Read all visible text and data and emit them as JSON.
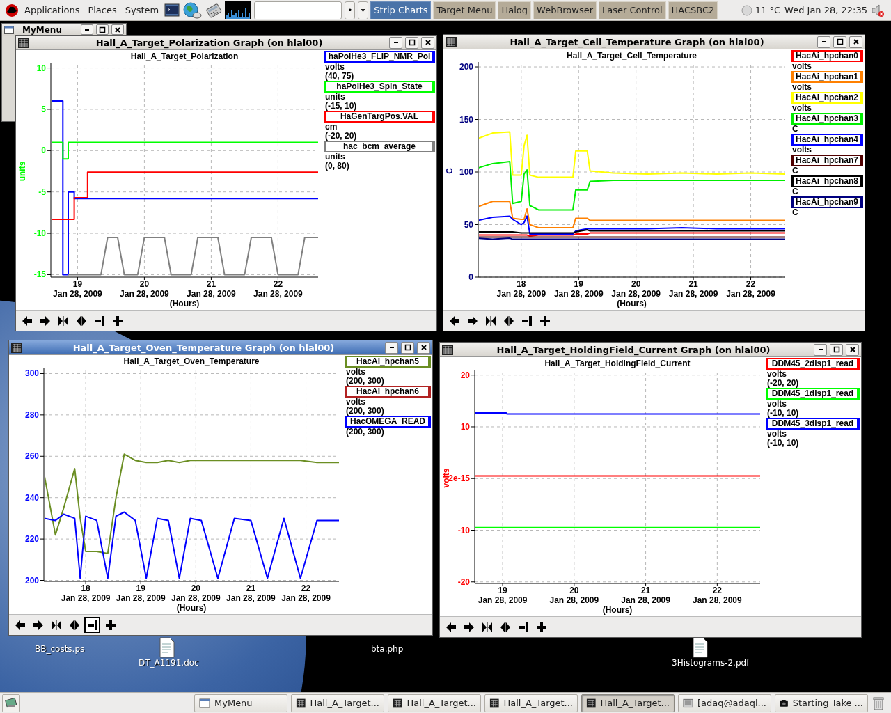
{
  "top_panel": {
    "menus": [
      "Applications",
      "Places",
      "System"
    ],
    "run_button": "•",
    "launchers": [
      {
        "label": "Strip Charts",
        "selected": true
      },
      {
        "label": "Target Menu",
        "selected": false
      },
      {
        "label": "Halog",
        "selected": false
      },
      {
        "label": "WebBrowser",
        "selected": false
      },
      {
        "label": "Laser Control",
        "selected": false
      },
      {
        "label": "HACSBC2",
        "selected": false
      }
    ],
    "weather": "11 °C",
    "clock": "Wed Jan 28, 22:35"
  },
  "mymenu": {
    "title": "MyMenu"
  },
  "windows": [
    {
      "title": "Hall_A_Target_Polarization Graph (on hlal00)",
      "active": false,
      "axis": {
        "color": "#00ff00"
      },
      "legend": [
        {
          "unit": "volts",
          "range": "(40, 75)"
        },
        {
          "unit": "units",
          "range": "(-15, 10)"
        },
        {
          "unit": "cm",
          "range": "(-20, 20)"
        },
        {
          "unit": "units",
          "range": "(0, 80)"
        }
      ],
      "date_labels": [
        "Jan 28, 2009",
        "Jan 28, 2009",
        "Jan 28, 2009",
        "Jan 28, 2009"
      ],
      "chart_data": {
        "type": "line",
        "title": "Hall_A_Target_Polarization",
        "xlabel": "(Hours)",
        "ylabel": "units",
        "grid": true,
        "x": [
          18.6,
          18.78,
          18.78,
          18.86,
          18.86,
          18.95,
          18.95,
          19.15,
          19.15,
          19.35,
          19.45,
          19.6,
          19.7,
          19.9,
          20.0,
          20.3,
          20.4,
          20.7,
          20.8,
          21.1,
          21.2,
          21.5,
          21.6,
          21.9,
          22.0,
          22.3,
          22.4,
          22.6
        ],
        "series": [
          {
            "name": "haPolHe3_FLIP_NMR_Pol",
            "color": "#0000ff",
            "values": [
              6,
              6,
              -15,
              -15,
              -5,
              -5,
              -5.8,
              -5.8,
              -5.8,
              -5.8,
              -5.8,
              -5.8,
              -5.8,
              -5.8,
              -5.8,
              -5.8,
              -5.8,
              -5.8,
              -5.8,
              -5.8,
              -5.8,
              -5.8,
              -5.8,
              -5.8,
              -5.8,
              -5.8,
              -5.8,
              -5.8
            ]
          },
          {
            "name": "haPolHe3_Spin_State",
            "color": "#00ff00",
            "values": [
              1,
              1,
              -1,
              -1,
              1,
              1,
              1,
              1,
              1,
              1,
              1,
              1,
              1,
              1,
              1,
              1,
              1,
              1,
              1,
              1,
              1,
              1,
              1,
              1,
              1,
              1,
              1,
              1
            ]
          },
          {
            "name": "HaGenTargPos.VAL",
            "color": "#ff0000",
            "values": [
              -8.3,
              -8.3,
              -8.3,
              -8.3,
              -8.3,
              -8.3,
              -5.7,
              -5.7,
              -2.6,
              -2.6,
              -2.6,
              -2.6,
              -2.6,
              -2.6,
              -2.6,
              -2.6,
              -2.6,
              -2.6,
              -2.6,
              -2.6,
              -2.6,
              -2.6,
              -2.6,
              -2.6,
              -2.6,
              -2.6,
              -2.6,
              -2.6
            ]
          },
          {
            "name": "hac_bcm_average",
            "color": "#808080",
            "values": [
              null,
              null,
              null,
              null,
              -15,
              -15,
              -15,
              -15,
              -15,
              -15,
              -10.5,
              -10.5,
              -15,
              -15,
              -10.5,
              -10.5,
              -15,
              -15,
              -10.5,
              -10.5,
              -15,
              -15,
              -10.5,
              -10.5,
              -15,
              -15,
              -10.5,
              -10.5
            ]
          }
        ],
        "xlim": [
          18.6,
          22.6
        ],
        "ylim": [
          -15.3,
          10.3
        ],
        "xticks": [
          19,
          20,
          21,
          22
        ],
        "yticks": [
          10,
          5,
          0,
          -5,
          -10,
          -15
        ]
      },
      "toolbar": [
        {
          "kind": "back",
          "selected": false
        },
        {
          "kind": "forward",
          "selected": false
        },
        {
          "kind": "zoom-in",
          "selected": false
        },
        {
          "kind": "zoom-out",
          "selected": false
        },
        {
          "kind": "fit",
          "selected": false
        },
        {
          "kind": "add",
          "selected": false
        }
      ]
    },
    {
      "title": "Hall_A_Target_Cell_Temperature Graph (on hlal00)",
      "active": false,
      "axis": {
        "color": "#000080"
      },
      "legend": [
        {
          "unit": "volts"
        },
        {
          "unit": "volts"
        },
        {
          "unit": "volts"
        },
        {
          "unit": "C"
        },
        {
          "unit": "volts"
        },
        {
          "unit": "C"
        },
        {
          "unit": "C"
        },
        {
          "unit": "C"
        }
      ],
      "date_labels": [
        "Jan 28, 2009",
        "Jan 28, 2009",
        "Jan 28, 2009",
        "Jan 28, 2009",
        "Jan 28, 2009"
      ],
      "chart_data": {
        "type": "line",
        "title": "Hall_A_Target_Cell_Temperature",
        "xlabel": "(Hours)",
        "ylabel": "C",
        "grid": true,
        "x": [
          17.25,
          17.5,
          17.8,
          17.85,
          18.0,
          18.05,
          18.1,
          18.15,
          18.3,
          18.9,
          18.95,
          19.15,
          19.2,
          19.6,
          20.2,
          20.8,
          21.4,
          22.0,
          22.6
        ],
        "series": [
          {
            "name": "HacAi_hpchan0",
            "color": "#ff0000",
            "values": [
              40,
              40,
              40,
              40,
              40,
              40,
              40,
              39,
              40,
              40,
              41,
              41,
              42,
              42,
              42,
              42,
              42,
              42,
              42
            ]
          },
          {
            "name": "HacAi_hpchan1",
            "color": "#ff8000",
            "values": [
              67,
              72,
              72,
              56,
              55,
              55,
              65,
              50,
              47,
              47,
              56,
              56,
              54,
              54,
              54,
              54,
              54,
              54,
              54
            ]
          },
          {
            "name": "HacAi_hpchan2",
            "color": "#ffff00",
            "values": [
              132,
              137,
              138,
              97,
              97,
              125,
              135,
              97,
              95,
              95,
              120,
              120,
              101,
              99,
              98,
              99,
              98,
              99,
              98
            ]
          },
          {
            "name": "HacAi_hpchan3",
            "color": "#00ee00",
            "values": [
              104,
              108,
              110,
              70,
              72,
              98,
              102,
              68,
              64,
              64,
              83,
              83,
              91,
              92,
              92,
              92,
              92,
              92,
              92
            ]
          },
          {
            "name": "HacAi_hpchan4",
            "color": "#0000ff",
            "values": [
              54,
              57,
              58,
              55,
              50,
              52,
              58,
              41,
              41,
              41,
              44,
              46,
              46,
              46,
              46,
              47,
              46,
              46,
              46
            ]
          },
          {
            "name": "HacAi_hpchan7",
            "color": "#500000",
            "values": [
              38,
              38,
              38,
              38,
              38,
              38,
              38,
              38,
              38,
              38,
              38,
              38,
              38,
              38,
              38,
              38,
              38,
              38,
              38
            ]
          },
          {
            "name": "HacAi_hpchan8",
            "color": "#000000",
            "values": [
              43,
              43,
              43,
              43,
              42,
              42,
              42,
              42,
              42,
              42,
              43,
              45,
              44,
              44,
              44,
              44,
              44,
              44,
              44
            ]
          },
          {
            "name": "HacAi_hpchan9",
            "color": "#000080",
            "values": [
              37,
              36,
              37,
              36,
              36,
              36,
              36,
              36,
              36,
              36,
              36,
              36,
              36,
              36,
              36,
              36,
              36,
              36,
              36
            ]
          }
        ],
        "xlim": [
          17.25,
          22.6
        ],
        "ylim": [
          0,
          202
        ],
        "xticks": [
          18,
          19,
          20,
          21,
          22
        ],
        "yticks": [
          0,
          50,
          100,
          150,
          200
        ]
      },
      "toolbar": [
        {
          "kind": "back",
          "selected": false
        },
        {
          "kind": "forward",
          "selected": false
        },
        {
          "kind": "zoom-in",
          "selected": false
        },
        {
          "kind": "zoom-out",
          "selected": false
        },
        {
          "kind": "fit",
          "selected": false
        },
        {
          "kind": "add",
          "selected": false
        }
      ]
    },
    {
      "title": "Hall_A_Target_Oven_Temperature Graph (on hlal00)",
      "active": true,
      "axis": {
        "color": "#0000ff"
      },
      "legend": [
        {
          "unit": "volts",
          "range": "(200, 300)"
        },
        {
          "unit": "volts",
          "range": "(200, 300)"
        },
        {
          "range": "(200, 300)"
        }
      ],
      "date_labels": [
        "Jan 28, 2009",
        "Jan 28, 2009",
        "Jan 28, 2009",
        "Jan 28, 2009",
        "Jan 28, 2009"
      ],
      "chart_data": {
        "type": "line",
        "title": "Hall_A_Target_Oven_Temperature",
        "xlabel": "(Hours)",
        "grid": true,
        "x": [
          17.24,
          17.45,
          17.6,
          17.8,
          17.9,
          18.0,
          18.2,
          18.4,
          18.55,
          18.7,
          18.9,
          19.1,
          19.3,
          19.5,
          19.7,
          19.9,
          20.1,
          20.4,
          20.7,
          21.0,
          21.3,
          21.6,
          21.9,
          22.2,
          22.6
        ],
        "series": [
          {
            "name": "HacAi_hpchan5",
            "color": "#6b8e23",
            "values": [
              252,
              222,
              235,
              254,
              230,
              214,
              214,
              213,
              240,
              261,
              258,
              257,
              257,
              258,
              257,
              258,
              258,
              258,
              258,
              258,
              258,
              258,
              258,
              257,
              257
            ]
          },
          {
            "name": "HacAi_hpchan6",
            "color": "#b22222",
            "values": [
              null,
              null,
              null,
              null,
              null,
              null,
              null,
              null,
              null,
              null,
              null,
              null,
              null,
              null,
              null,
              null,
              null,
              null,
              null,
              null,
              null,
              null,
              null,
              null,
              null
            ]
          },
          {
            "name": "HacOMEGA_READ",
            "color": "#0000ff",
            "values": [
              230,
              229,
              232,
              230,
              201,
              231,
              229,
              201,
              231,
              233,
              229,
              201,
              230,
              229,
              201,
              230,
              229,
              201,
              230,
              229,
              201,
              230,
              201,
              229,
              229
            ]
          }
        ],
        "xlim": [
          17.24,
          22.6
        ],
        "ylim": [
          199.5,
          301.5
        ],
        "xticks": [
          18,
          19,
          20,
          21,
          22
        ],
        "yticks": [
          300,
          280,
          260,
          240,
          220,
          200
        ]
      },
      "toolbar": [
        {
          "kind": "back",
          "selected": false
        },
        {
          "kind": "forward",
          "selected": false
        },
        {
          "kind": "zoom-in",
          "selected": false
        },
        {
          "kind": "zoom-out",
          "selected": false
        },
        {
          "kind": "fit",
          "selected": true
        },
        {
          "kind": "add",
          "selected": false
        }
      ]
    },
    {
      "title": "Hall_A_Target_HoldingField_Current Graph (on hlal00)",
      "active": false,
      "axis": {
        "color": "#ff0000"
      },
      "legend": [
        {
          "unit": "volts",
          "range": "(-20, 20)"
        },
        {
          "unit": "volts",
          "range": "(-10, 10)"
        },
        {
          "unit": "volts",
          "range": "(-10, 10)"
        }
      ],
      "date_labels": [
        "Jan 28, 2009",
        "Jan 28, 2009",
        "Jan 28, 2009",
        "Jan 28, 2009"
      ],
      "chart_data": {
        "type": "line",
        "title": "Hall_A_Target_HoldingField_Current",
        "xlabel": "(Hours)",
        "ylabel": "volts",
        "grid": true,
        "x": [
          18.61,
          19.05,
          19.06,
          22.6
        ],
        "series": [
          {
            "name": "DDM45_2disp1_read",
            "color": "#ff0000",
            "values": [
              0.5,
              0.5,
              0.5,
              0.5
            ]
          },
          {
            "name": "DDM45_1disp1_read",
            "color": "#00ff00",
            "values": [
              -9.5,
              -9.5,
              -9.5,
              -9.5
            ]
          },
          {
            "name": "DDM45_3disp1_read",
            "color": "#0000ff",
            "values": [
              12.7,
              12.7,
              12.5,
              12.5
            ]
          }
        ],
        "xlim": [
          18.61,
          22.6
        ],
        "ylim": [
          -20.3,
          20.5
        ],
        "xticks": [
          19,
          20,
          21,
          22
        ],
        "yticks": [
          20,
          10,
          {
            "value": 0,
            "label": "2e-15"
          },
          -10,
          -20
        ]
      },
      "toolbar": [
        {
          "kind": "back",
          "selected": false
        },
        {
          "kind": "forward",
          "selected": false
        },
        {
          "kind": "zoom-in",
          "selected": false
        },
        {
          "kind": "zoom-out",
          "selected": false
        },
        {
          "kind": "fit",
          "selected": false
        },
        {
          "kind": "add",
          "selected": false
        }
      ]
    }
  ],
  "desktop_icons": [
    {
      "label": "BB_costs.ps"
    },
    {
      "label": "DT_A1191.doc"
    },
    {
      "label": "bta.php"
    },
    {
      "label": "3Histograms-2.pdf"
    }
  ],
  "taskbar": {
    "tasks": [
      {
        "label": "MyMenu",
        "kind": "window",
        "selected": false
      },
      {
        "label": "Hall_A_Target...",
        "kind": "graph",
        "selected": false
      },
      {
        "label": "Hall_A_Target...",
        "kind": "graph",
        "selected": false
      },
      {
        "label": "Hall_A_Target...",
        "kind": "graph",
        "selected": false
      },
      {
        "label": "Hall_A_Target...",
        "kind": "graph",
        "selected": true
      },
      {
        "label": "[adaq@adaql...",
        "kind": "terminal",
        "selected": false
      },
      {
        "label": "Starting Take ...",
        "kind": "camera",
        "selected": false
      }
    ]
  }
}
